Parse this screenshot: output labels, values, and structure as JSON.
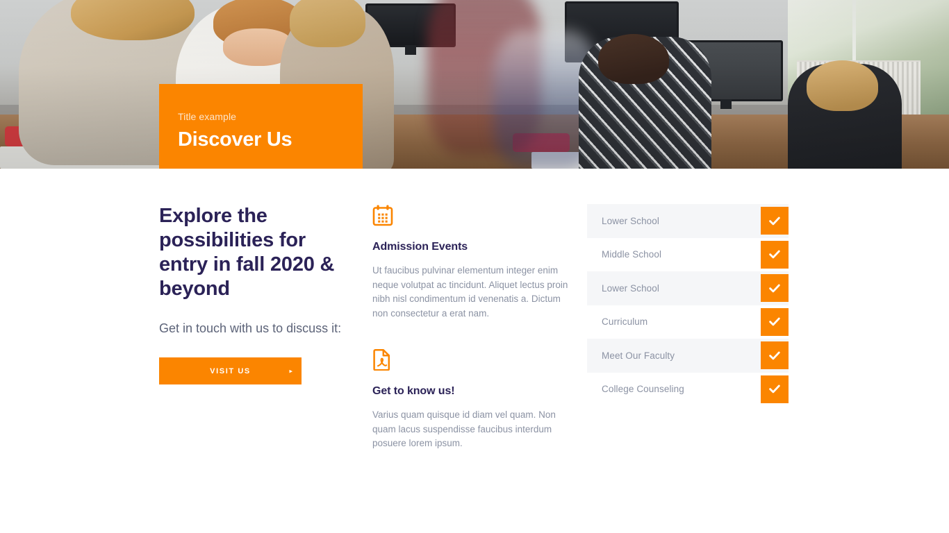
{
  "colors": {
    "orange": "#fb8500",
    "heading_navy": "#2b2257",
    "body_gray": "#8b92a3",
    "lead_gray": "#5c6378",
    "row_alt": "#f5f6f8"
  },
  "hero": {
    "kicker": "Title example",
    "title": "Discover Us",
    "image_alt": "classroom-photo"
  },
  "left": {
    "heading": "Explore the possibilities for entry in fall 2020 & beyond",
    "lead": "Get in touch with us to discuss it:",
    "button_label": "VISIT US",
    "button_arrow": "▸"
  },
  "features": [
    {
      "icon": "calendar-icon",
      "title": "Admission Events",
      "body": "Ut faucibus pulvinar elementum integer enim neque volutpat ac tincidunt. Aliquet lectus proin nibh nisl condimentum id venenatis a. Dictum non consectetur a erat nam."
    },
    {
      "icon": "pdf-file-icon",
      "title": "Get to know us!",
      "body": "Varius quam quisque id diam vel quam. Non quam lacus suspendisse faucibus interdum posuere lorem ipsum."
    }
  ],
  "links": [
    {
      "label": "Lower School"
    },
    {
      "label": "Middle School"
    },
    {
      "label": "Lower School"
    },
    {
      "label": "Curriculum"
    },
    {
      "label": "Meet Our Faculty"
    },
    {
      "label": "College Counseling"
    }
  ]
}
